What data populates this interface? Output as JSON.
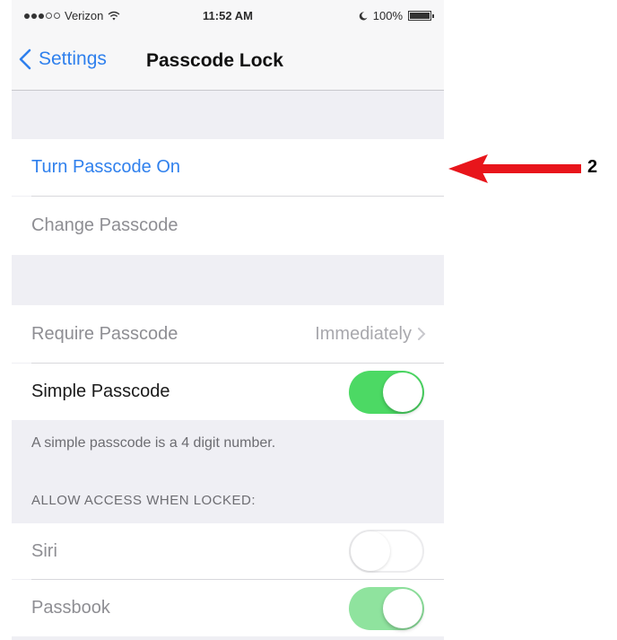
{
  "status_bar": {
    "carrier": "Verizon",
    "time": "11:52 AM",
    "battery": "100%"
  },
  "nav": {
    "back_label": "Settings",
    "title": "Passcode Lock"
  },
  "cells": {
    "turn_passcode_on": "Turn Passcode On",
    "change_passcode": "Change Passcode",
    "require_passcode": {
      "label": "Require Passcode",
      "value": "Immediately"
    },
    "simple_passcode": {
      "label": "Simple Passcode",
      "state": "on"
    },
    "simple_footer": "A simple passcode is a 4 digit number.",
    "allow_access_header": "ALLOW ACCESS WHEN LOCKED:",
    "siri": {
      "label": "Siri",
      "state": "off"
    },
    "passbook": {
      "label": "Passbook",
      "state": "on"
    }
  },
  "annotation": {
    "step": "2",
    "arrow_color": "#e8151b"
  },
  "colors": {
    "accent": "#2f80ed",
    "toggle_on": "#4cd964"
  }
}
